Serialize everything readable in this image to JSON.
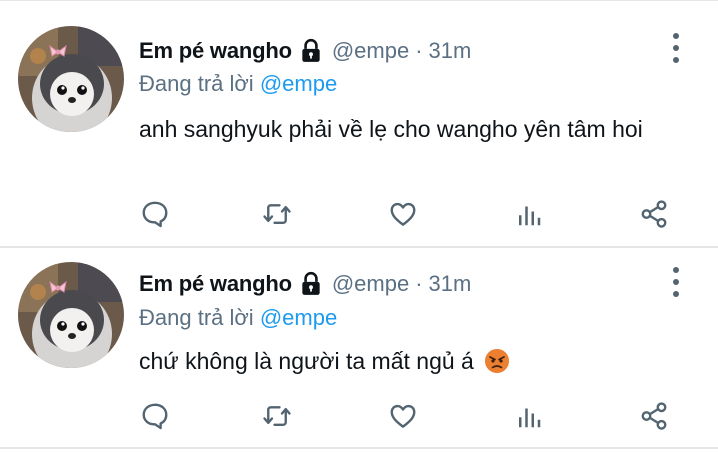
{
  "tweets": [
    {
      "author_name": "Em pé wangho",
      "handle": "@empe",
      "separator": "·",
      "time": "31m",
      "reply_prefix": "Đang trả lời",
      "reply_to": "@empe",
      "text": "anh sanghyuk phải về lẹ cho wangho yên tâm hoi",
      "icons": {
        "avatar": "penguin-avatar",
        "protected": "lock-icon",
        "more": "more-vertical-icon",
        "actions": [
          "reply-icon",
          "retweet-icon",
          "like-icon",
          "analytics-icon",
          "share-icon"
        ]
      }
    },
    {
      "author_name": "Em pé wangho",
      "handle": "@empe",
      "separator": "·",
      "time": "31m",
      "reply_prefix": "Đang trả lời",
      "reply_to": "@empe",
      "text": "chứ không là người ta mất ngủ á",
      "emoji": "angry-face-emoji",
      "icons": {
        "avatar": "penguin-avatar",
        "protected": "lock-icon",
        "more": "more-vertical-icon",
        "actions": [
          "reply-icon",
          "retweet-icon",
          "like-icon",
          "analytics-icon",
          "share-icon"
        ]
      }
    }
  ],
  "colors": {
    "text": "#0f1419",
    "secondary": "#5b7083",
    "link": "#1d9bf0",
    "divider": "#e6e6e6",
    "icon": "#536471"
  }
}
